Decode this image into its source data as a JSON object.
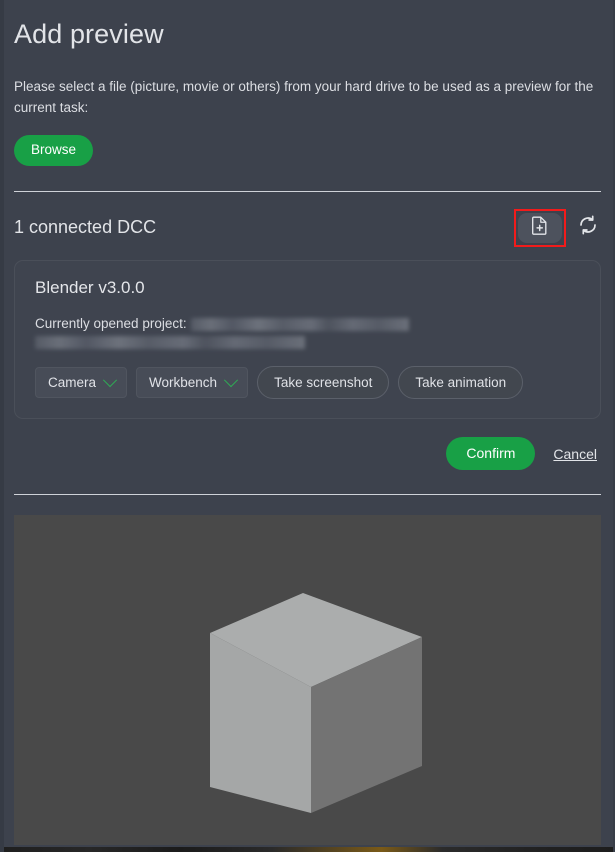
{
  "page": {
    "title": "Add preview",
    "instructions": "Please select a file (picture, movie or others) from your hard drive to be used as a preview for the current task:",
    "browse_label": "Browse"
  },
  "dcc": {
    "header_title": "1 connected DCC",
    "add_file_icon": "document-plus-icon",
    "refresh_icon": "refresh-icon",
    "highlight_color": "#f21b1b",
    "card": {
      "name": "Blender v3.0.0",
      "project_label": "Currently opened project:",
      "project_value": "",
      "camera_select": "Camera",
      "renderer_select": "Workbench",
      "take_screenshot_label": "Take screenshot",
      "take_animation_label": "Take animation",
      "chevron_icon": "chevron-down-icon",
      "chevron_color": "#2faa55"
    }
  },
  "actions": {
    "confirm_label": "Confirm",
    "cancel_label": "Cancel",
    "confirm_color": "#18a046"
  },
  "preview": {
    "alt": "blender-default-cube-render",
    "background_color": "#494949",
    "cube": {
      "top_face_color": "#a9abab",
      "left_face_color": "#a4a6a6",
      "right_face_color": "#727272"
    }
  },
  "theme": {
    "app_background": "#3d424d",
    "card_background": "#3f444f",
    "text_color": "#dcdee3",
    "divider_color": "#cfd2d8"
  }
}
